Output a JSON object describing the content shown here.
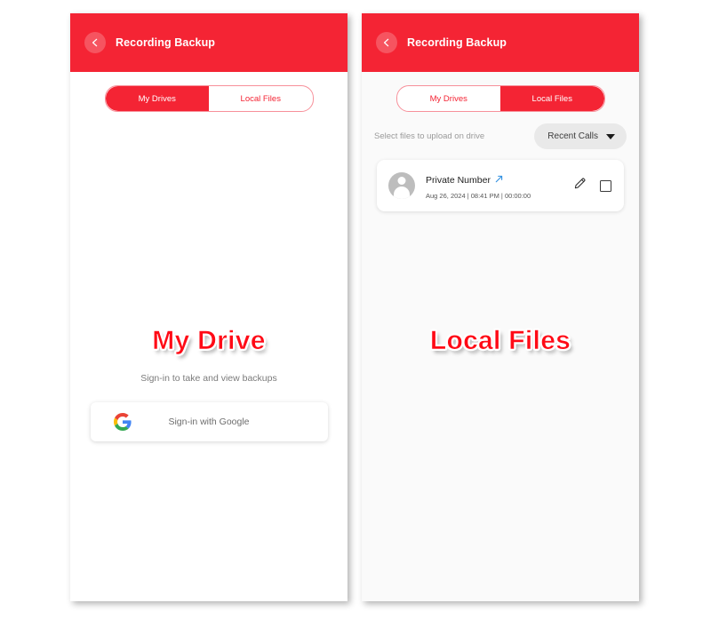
{
  "theme": {
    "primary_red": "#F42434",
    "overlay_red": "#FF0A16",
    "tab_border": "#F7909A",
    "page_bg": "#FFFFFF",
    "panel_bg": "#FAFAFA",
    "card_bg": "#FFFFFF",
    "muted_text": "#9A9A9A",
    "link_blue": "#2F8FE0",
    "google_blue": "#4285F4",
    "google_red": "#EA4335",
    "google_yellow": "#FBBC05",
    "google_green": "#34A853"
  },
  "left_panel": {
    "appbar": {
      "title": "Recording Backup",
      "back_icon": "chevron-left-icon"
    },
    "tabs": [
      {
        "label": "My Drives",
        "active": true
      },
      {
        "label": "Local Files",
        "active": false
      }
    ],
    "overlay_label": "My Drive",
    "signin": {
      "subtitle": "Sign-in to take and view backups",
      "button_label": "Sign-in with Google",
      "button_icon": "google-g-icon"
    }
  },
  "right_panel": {
    "appbar": {
      "title": "Recording Backup",
      "back_icon": "chevron-left-icon"
    },
    "tabs": [
      {
        "label": "My Drives",
        "active": false
      },
      {
        "label": "Local Files",
        "active": true
      }
    ],
    "select_hint": "Select files to upload on drive",
    "filter_dropdown": {
      "value": "Recent Calls",
      "icon": "chevron-down-icon"
    },
    "files": [
      {
        "name": "Private Number",
        "call_direction_icon": "outgoing-call-arrow-icon",
        "meta": "Aug 26, 2024 | 08:41 PM | 00:00:00",
        "avatar_icon": "person-avatar-icon",
        "edit_icon": "pencil-icon",
        "checkbox_checked": false
      }
    ],
    "overlay_label": "Local Files"
  }
}
